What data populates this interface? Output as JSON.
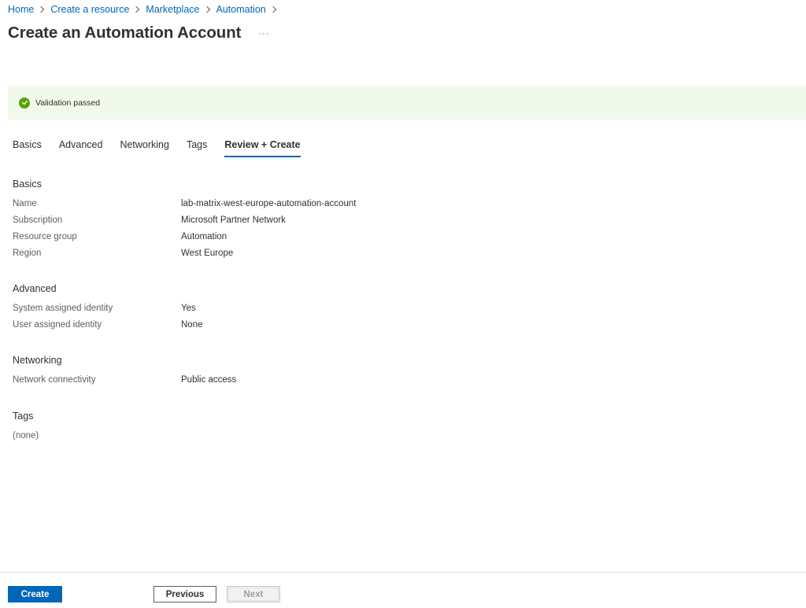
{
  "breadcrumb": {
    "items": [
      "Home",
      "Create a resource",
      "Marketplace",
      "Automation"
    ]
  },
  "header": {
    "title": "Create an Automation Account",
    "more_label": "···"
  },
  "validation": {
    "text": "Validation passed",
    "icon": "check-circle-icon",
    "color": "#57a300",
    "background": "#f1f9ea"
  },
  "tabs": [
    {
      "label": "Basics",
      "active": false
    },
    {
      "label": "Advanced",
      "active": false
    },
    {
      "label": "Networking",
      "active": false
    },
    {
      "label": "Tags",
      "active": false
    },
    {
      "label": "Review + Create",
      "active": true
    }
  ],
  "sections": {
    "basics": {
      "title": "Basics",
      "rows": [
        {
          "label": "Name",
          "value": "lab-matrix-west-europe-automation-account"
        },
        {
          "label": "Subscription",
          "value": "Microsoft Partner Network"
        },
        {
          "label": "Resource group",
          "value": "Automation"
        },
        {
          "label": "Region",
          "value": "West Europe"
        }
      ]
    },
    "advanced": {
      "title": "Advanced",
      "rows": [
        {
          "label": "System assigned identity",
          "value": "Yes"
        },
        {
          "label": "User assigned identity",
          "value": "None"
        }
      ]
    },
    "networking": {
      "title": "Networking",
      "rows": [
        {
          "label": "Network connectivity",
          "value": "Public access"
        }
      ]
    },
    "tags": {
      "title": "Tags",
      "none_text": "(none)"
    }
  },
  "footer": {
    "create_label": "Create",
    "previous_label": "Previous",
    "next_label": "Next"
  },
  "colors": {
    "accent": "#0067b8",
    "success": "#57a300"
  }
}
